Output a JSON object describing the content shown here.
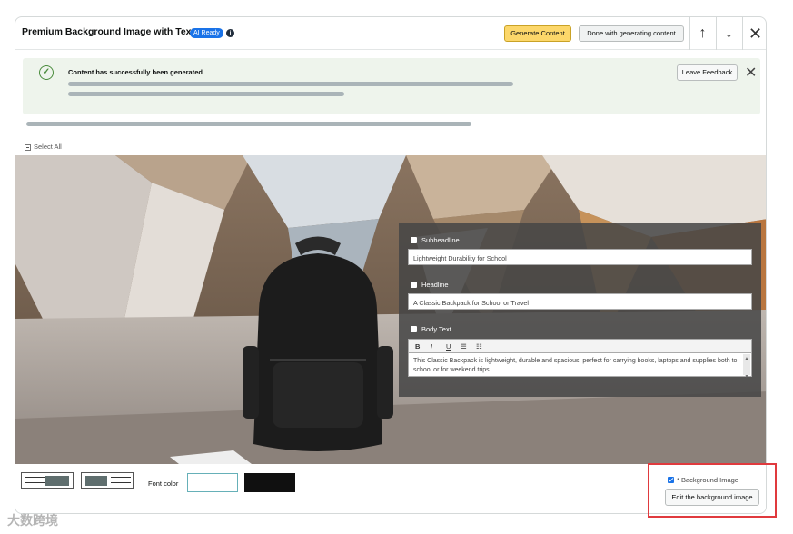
{
  "header": {
    "title": "Premium Background Image with Text",
    "badge": "AI Ready",
    "info_icon": "i",
    "generate_label": "Generate Content",
    "done_label": "Done with generating content",
    "up_icon": "↑",
    "down_icon": "↓",
    "close_icon": "✕"
  },
  "alert": {
    "message": "Content has successfully been generated",
    "check_icon": "✓",
    "feedback_label": "Leave Feedback",
    "close_icon": "✕"
  },
  "select_all": "Select All",
  "panel": {
    "subheadline_label": "Subheadline",
    "subheadline_value": "Lightweight Durability for School",
    "headline_label": "Headline",
    "headline_value": "A Classic Backpack for School or Travel",
    "body_label": "Body Text",
    "toolbar": {
      "bold": "B",
      "italic": "I",
      "underline": "U",
      "bullets": "☰",
      "numbered": "☷"
    },
    "body_value": "This Classic Backpack is lightweight, durable and spacious, perfect for carrying books, laptops and supplies both to school or for weekend trips."
  },
  "footer": {
    "font_color_label": "Font color",
    "background_image_label": "* Background Image",
    "edit_bg_label": "Edit the background image"
  },
  "colors": {
    "accent": "#1a73e8",
    "generate_button": "#fcd76a",
    "success_bg": "#eef4ec",
    "highlight": "#e03a3e"
  },
  "watermark": "大数跨境"
}
